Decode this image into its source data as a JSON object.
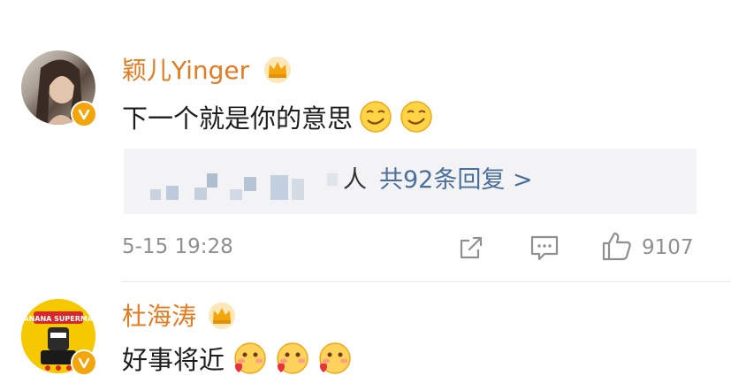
{
  "comments": [
    {
      "username": "颖儿Yinger",
      "text": "下一个就是你的意思",
      "reply_suffix": "人",
      "reply_link": "共92条回复 >",
      "timestamp": "5-15 19:28",
      "likes": "9107",
      "emoji": "smirk-emoji",
      "emoji_count": 2
    },
    {
      "username": "杜海涛",
      "text": "好事将近",
      "avatar_text": "BANANA SUPERMAN",
      "emoji": "blush-heart-emoji",
      "emoji_count": 3
    }
  ],
  "icons": [
    "crown-icon",
    "verified-v-icon",
    "share-icon",
    "comment-icon",
    "thumbs-up-icon"
  ],
  "colors": {
    "username": "#e57a1e",
    "reply_link": "#4a6f9c",
    "badge": "#f2a60c",
    "meta": "#8f8f8f",
    "reply_bg": "#f3f3f5"
  }
}
